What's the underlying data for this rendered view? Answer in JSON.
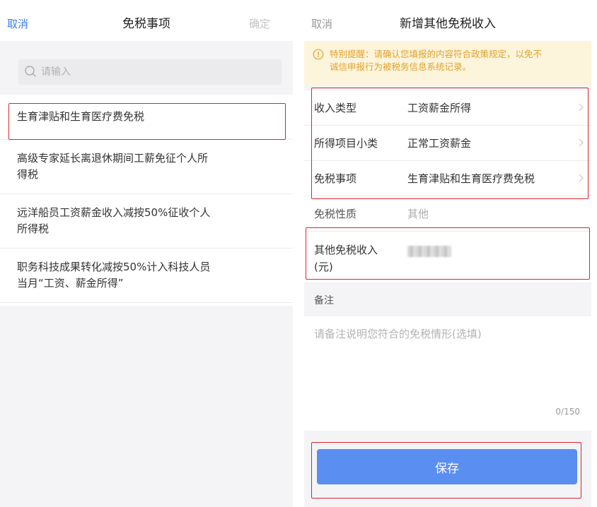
{
  "colors": {
    "accent": "#3a7cf2",
    "highlight_border": "#d9262c",
    "notice_text": "#e2a22a",
    "save_button": "#5a8ef1"
  },
  "left": {
    "header": {
      "cancel": "取消",
      "title": "免税事项",
      "confirm": "确定"
    },
    "search": {
      "placeholder": "请输入",
      "icon": "search-icon"
    },
    "items": [
      {
        "text": "生育津贴和生育医疗费免税"
      },
      {
        "line1": "高级专家延长离退休期间工薪免征个人所",
        "line2": "得税"
      },
      {
        "line1": "远洋船员工资薪金收入减按50%征收个人",
        "line2": "所得税"
      },
      {
        "line1": "职务科技成果转化减按50%计入科技人员",
        "line2": "当月“工资、薪金所得”"
      }
    ]
  },
  "right": {
    "header": {
      "cancel": "取消",
      "title": "新增其他免税收入"
    },
    "notice": {
      "icon": "warning-circle-icon",
      "line1": "特别提醒：请确认您填报的内容符合政策规定，以免不",
      "line2": "诚信申报行为被税务信息系统记录。"
    },
    "rows": [
      {
        "label": "收入类型",
        "value": "工资薪金所得"
      },
      {
        "label": "所得项目小类",
        "value": "正常工资薪金"
      },
      {
        "label": "免税事项",
        "value": "生育津贴和生育医疗费免税"
      }
    ],
    "nature": {
      "label": "免税性质",
      "value": "其他"
    },
    "income": {
      "label_line1": "其他免税收入",
      "label_line2": "(元)"
    },
    "remark": {
      "title": "备注",
      "placeholder": "请备注说明您符合的免税情形(选填)",
      "counter": "0/150"
    },
    "save": "保存"
  }
}
